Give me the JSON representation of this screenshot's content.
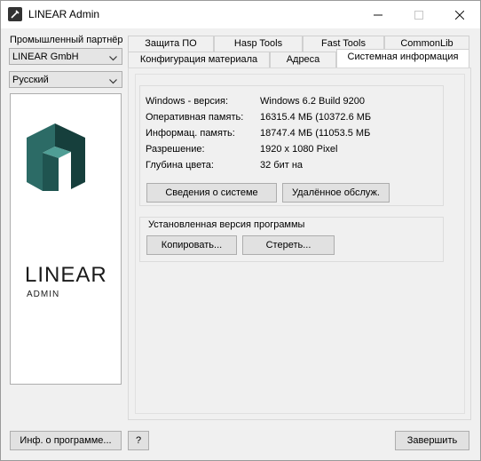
{
  "window": {
    "title": "LINEAR Admin"
  },
  "left": {
    "partner_label": "Промышленный партнёр",
    "partner_value": "LINEAR GmbH",
    "language_value": "Русский",
    "logo_word": "LINEAR",
    "logo_sub": "ADMIN"
  },
  "tabs_row1": [
    "Защита ПО",
    "Hasp Tools",
    "Fast Tools",
    "CommonLib"
  ],
  "tabs_row2": [
    "Конфигурация материала",
    "Адреса",
    "Системная информация"
  ],
  "sysinfo": {
    "rows": [
      {
        "label": "Windows - версия:",
        "value": "Windows 6.2 Build 9200"
      },
      {
        "label": "Оперативная память:",
        "value": "16315.4 МБ (10372.6 МБ"
      },
      {
        "label": "Информац. память:",
        "value": "18747.4 МБ (11053.5 МБ"
      },
      {
        "label": "Разрешение:",
        "value": "1920 x 1080 Pixel"
      },
      {
        "label": "Глубина цвета:",
        "value": "32 бит на"
      }
    ],
    "system_info_button": "Сведения о системе",
    "remote_service_button": "Удалённое обслуж."
  },
  "installed": {
    "group_title": "Установленная версия программы",
    "copy_button": "Копировать...",
    "delete_button": "Стереть..."
  },
  "footer": {
    "about_button": "Инф. о программе...",
    "help_button": "?",
    "exit_button": "Завершить"
  }
}
